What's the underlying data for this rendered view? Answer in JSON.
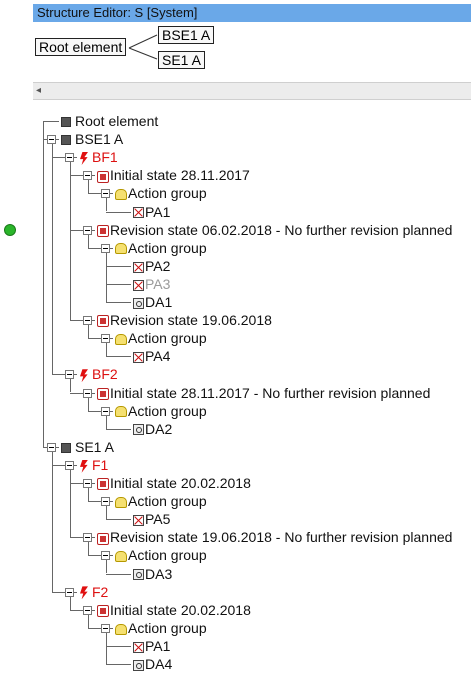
{
  "window": {
    "title": "Structure Editor: S [System]"
  },
  "graph": {
    "root_label": "Root element",
    "child1_label": "BSE1 A",
    "child2_label": "SE1 A"
  },
  "tree": {
    "rows": [
      {
        "label": "Root element",
        "icon": "square-icon",
        "color": "normal"
      },
      {
        "label": "BSE1 A",
        "icon": "square-icon",
        "color": "normal"
      },
      {
        "label": "BF1",
        "icon": "fault-icon",
        "color": "red"
      },
      {
        "label": "Initial state 28.11.2017",
        "icon": "state-icon",
        "color": "normal"
      },
      {
        "label": "Action group",
        "icon": "action-group-icon",
        "color": "normal"
      },
      {
        "label": "PA1",
        "icon": "pa-icon",
        "color": "normal"
      },
      {
        "label": "Revision state 06.02.2018 - No further revision planned",
        "icon": "state-icon",
        "color": "normal"
      },
      {
        "label": "Action group",
        "icon": "action-group-icon",
        "color": "normal"
      },
      {
        "label": "PA2",
        "icon": "pa-icon",
        "color": "normal"
      },
      {
        "label": "PA3",
        "icon": "pa-icon",
        "color": "gray"
      },
      {
        "label": "DA1",
        "icon": "da-icon",
        "color": "normal"
      },
      {
        "label": "Revision state 19.06.2018",
        "icon": "state-icon",
        "color": "normal"
      },
      {
        "label": "Action group",
        "icon": "action-group-icon",
        "color": "normal"
      },
      {
        "label": "PA4",
        "icon": "pa-icon",
        "color": "normal"
      },
      {
        "label": "BF2",
        "icon": "fault-icon",
        "color": "red"
      },
      {
        "label": "Initial state 28.11.2017 - No further revision planned",
        "icon": "state-icon",
        "color": "normal"
      },
      {
        "label": "Action group",
        "icon": "action-group-icon",
        "color": "normal"
      },
      {
        "label": "DA2",
        "icon": "da-icon",
        "color": "normal"
      },
      {
        "label": "SE1 A",
        "icon": "square-icon",
        "color": "normal"
      },
      {
        "label": "F1",
        "icon": "fault-icon",
        "color": "red"
      },
      {
        "label": "Initial state 20.02.2018",
        "icon": "state-icon",
        "color": "normal"
      },
      {
        "label": "Action group",
        "icon": "action-group-icon",
        "color": "normal"
      },
      {
        "label": "PA5",
        "icon": "pa-icon",
        "color": "normal"
      },
      {
        "label": "Revision state 19.06.2018 - No further revision planned",
        "icon": "state-icon",
        "color": "normal"
      },
      {
        "label": "Action group",
        "icon": "action-group-icon",
        "color": "normal"
      },
      {
        "label": "DA3",
        "icon": "da-icon",
        "color": "normal"
      },
      {
        "label": "F2",
        "icon": "fault-icon",
        "color": "red"
      },
      {
        "label": "Initial state 20.02.2018",
        "icon": "state-icon",
        "color": "normal"
      },
      {
        "label": "Action group",
        "icon": "action-group-icon",
        "color": "normal"
      },
      {
        "label": "PA1",
        "icon": "pa-icon",
        "color": "normal"
      },
      {
        "label": "DA4",
        "icon": "da-icon",
        "color": "normal"
      }
    ]
  },
  "colors": {
    "title_bar": "#6aa8e8",
    "fault_text": "#dd1111",
    "indicator": "#2ab52a"
  }
}
